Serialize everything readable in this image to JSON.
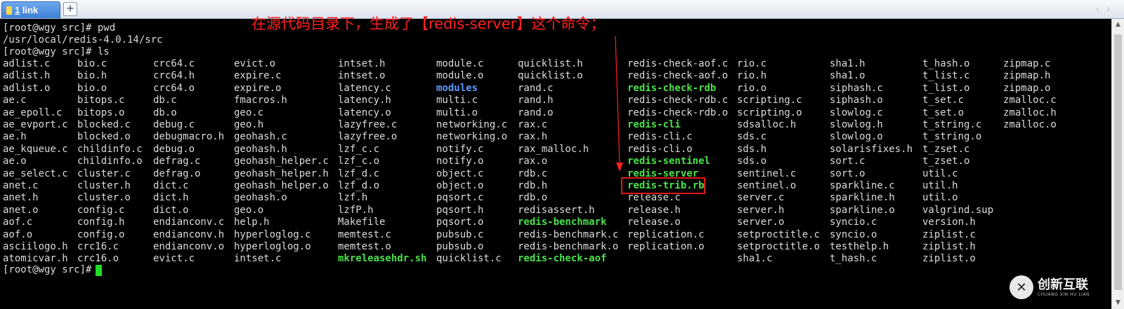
{
  "tab": {
    "number": "1",
    "label": "link"
  },
  "new_tab_symbol": "+",
  "terminal": {
    "header_lines": [
      "[root@wgy src]# pwd",
      "/usr/local/redis-4.0.14/src",
      "[root@wgy src]# ls"
    ],
    "columns": [
      [
        "adlist.c",
        "adlist.h",
        "adlist.o",
        "ae.c",
        "ae_epoll.c",
        "ae_evport.c",
        "ae.h",
        "ae_kqueue.c",
        "ae.o",
        "ae_select.c",
        "anet.c",
        "anet.h",
        "anet.o",
        "aof.c",
        "aof.o",
        "asciilogo.h",
        "atomicvar.h"
      ],
      [
        "bio.c",
        "bio.h",
        "bio.o",
        "bitops.c",
        "bitops.o",
        "blocked.c",
        "blocked.o",
        "childinfo.c",
        "childinfo.o",
        "cluster.c",
        "cluster.h",
        "cluster.o",
        "config.c",
        "config.h",
        "config.o",
        "crc16.c",
        "crc16.o"
      ],
      [
        "crc64.c",
        "crc64.h",
        "crc64.o",
        "db.c",
        "db.o",
        "debug.c",
        "debugmacro.h",
        "debug.o",
        "defrag.c",
        "defrag.o",
        "dict.c",
        "dict.h",
        "dict.o",
        "endianconv.c",
        "endianconv.h",
        "endianconv.o",
        "evict.c"
      ],
      [
        "evict.o",
        "expire.c",
        "expire.o",
        "fmacros.h",
        "geo.c",
        "geo.h",
        "geohash.c",
        "geohash.h",
        "geohash_helper.c",
        "geohash_helper.h",
        "geohash_helper.o",
        "geohash.o",
        "geo.o",
        "help.h",
        "hyperloglog.c",
        "hyperloglog.o",
        "intset.c"
      ],
      [
        "intset.h",
        "intset.o",
        "latency.c",
        "latency.h",
        "latency.o",
        "lazyfree.c",
        "lazyfree.o",
        "lzf_c.c",
        "lzf_c.o",
        "lzf_d.c",
        "lzf_d.o",
        "lzf.h",
        "lzfP.h",
        "Makefile",
        "memtest.c",
        "memtest.o",
        "mkreleasehdr.sh"
      ],
      [
        "module.c",
        "module.o",
        "modules",
        "multi.c",
        "multi.o",
        "networking.c",
        "networking.o",
        "notify.c",
        "notify.o",
        "object.c",
        "object.o",
        "pqsort.c",
        "pqsort.h",
        "pqsort.o",
        "pubsub.c",
        "pubsub.o",
        "quicklist.c"
      ],
      [
        "quicklist.h",
        "quicklist.o",
        "rand.c",
        "rand.h",
        "rand.o",
        "rax.c",
        "rax.h",
        "rax_malloc.h",
        "rax.o",
        "rdb.c",
        "rdb.h",
        "rdb.o",
        "redisassert.h",
        "redis-benchmark",
        "redis-benchmark.c",
        "redis-benchmark.o",
        "redis-check-aof"
      ],
      [
        "redis-check-aof.c",
        "redis-check-aof.o",
        "redis-check-rdb",
        "redis-check-rdb.c",
        "redis-check-rdb.o",
        "redis-cli",
        "redis-cli.c",
        "redis-cli.o",
        "redis-sentinel",
        "redis-server",
        "redis-trib.rb",
        "release.c",
        "release.h",
        "release.o",
        "replication.c",
        "replication.o"
      ],
      [
        "rio.c",
        "rio.h",
        "rio.o",
        "scripting.c",
        "scripting.o",
        "sdsalloc.h",
        "sds.c",
        "sds.h",
        "sds.o",
        "sentinel.c",
        "sentinel.o",
        "server.c",
        "server.h",
        "server.o",
        "setproctitle.c",
        "setproctitle.o",
        "sha1.c"
      ],
      [
        "sha1.h",
        "sha1.o",
        "siphash.c",
        "siphash.o",
        "slowlog.c",
        "slowlog.h",
        "slowlog.o",
        "solarisfixes.h",
        "sort.c",
        "sort.o",
        "sparkline.c",
        "sparkline.h",
        "sparkline.o",
        "syncio.c",
        "syncio.o",
        "testhelp.h",
        "t_hash.c"
      ],
      [
        "t_hash.o",
        "t_list.c",
        "t_list.o",
        "t_set.c",
        "t_set.o",
        "t_string.c",
        "t_string.o",
        "t_zset.c",
        "t_zset.o",
        "util.c",
        "util.h",
        "util.o",
        "valgrind.sup",
        "version.h",
        "ziplist.c",
        "ziplist.h",
        "ziplist.o"
      ],
      [
        "zipmap.c",
        "zipmap.h",
        "zipmap.o",
        "zmalloc.c",
        "zmalloc.h",
        "zmalloc.o"
      ]
    ],
    "directories": [
      "modules"
    ],
    "executables": [
      "mkreleasehdr.sh",
      "redis-benchmark",
      "redis-check-aof",
      "redis-check-rdb",
      "redis-cli",
      "redis-sentinel",
      "redis-server",
      "redis-trib.rb"
    ],
    "prompt": "[root@wgy src]# ",
    "colors": {
      "text": "#dcdcdc",
      "directory": "#5c9cff",
      "executable": "#4ae04a",
      "cursor": "#22dd22",
      "background": "#000000"
    }
  },
  "annotation": {
    "text": "在源代码目录下，生成了【redis-server】这个命令；",
    "highlighted_item": "redis-server",
    "color": "#ff2020"
  },
  "watermark": {
    "logo_glyph": "✕",
    "title": "创新互联",
    "subtitle": "CHUANG XIN HU LIAN"
  },
  "scrollbar": {
    "up_icon": "▲",
    "down_icon": "▼"
  }
}
